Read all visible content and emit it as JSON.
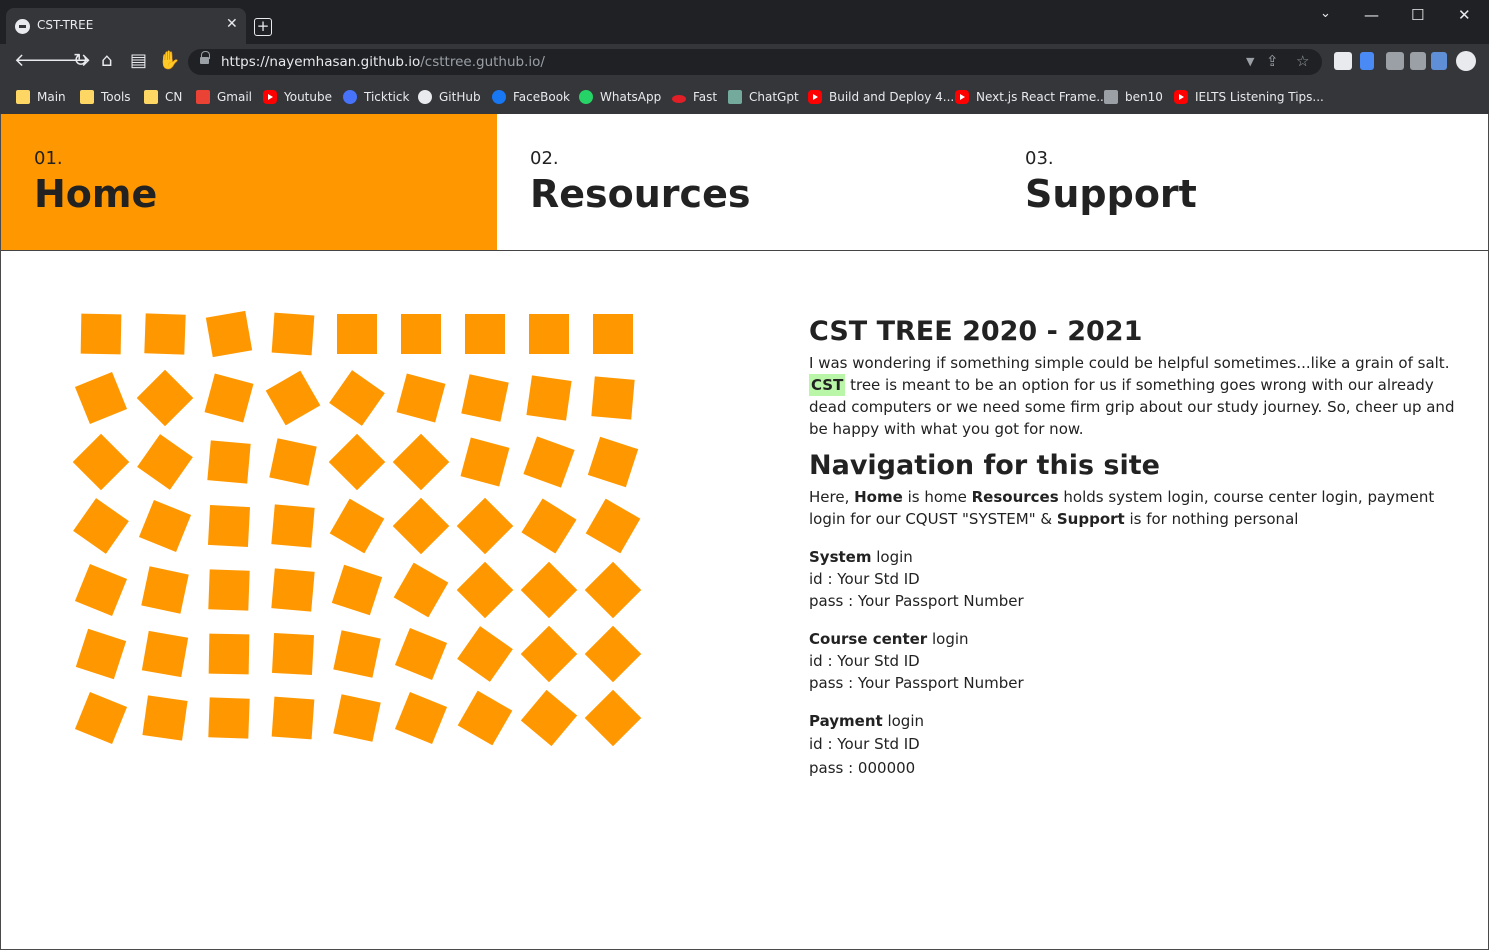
{
  "browser": {
    "tab_title": "CST-TREE",
    "tab_close": "✕",
    "new_tab": "+",
    "window_controls": [
      "⌄",
      "—",
      "☐",
      "✕"
    ],
    "url_host": "https://nayemhasan.github.io",
    "url_path": "/csttree.guthub.io/",
    "nav_icons": [
      "back-icon",
      "forward-icon",
      "reload-icon",
      "home-icon",
      "panel-icon",
      "hand-icon"
    ],
    "bookmarks": [
      {
        "label": "Main",
        "icon": "folder-icon"
      },
      {
        "label": "Tools",
        "icon": "folder-icon"
      },
      {
        "label": "CN",
        "icon": "folder-icon"
      },
      {
        "label": "Gmail",
        "icon": "gmail-icon"
      },
      {
        "label": "Youtube",
        "icon": "youtube-icon"
      },
      {
        "label": "Ticktick",
        "icon": "ticktick-icon"
      },
      {
        "label": "GitHub",
        "icon": "github-icon"
      },
      {
        "label": "FaceBook",
        "icon": "facebook-icon"
      },
      {
        "label": "WhatsApp",
        "icon": "whatsapp-icon"
      },
      {
        "label": "Fast",
        "icon": "fast-icon"
      },
      {
        "label": "ChatGpt",
        "icon": "chatgpt-icon"
      },
      {
        "label": "Build and Deploy 4...",
        "icon": "youtube-icon"
      },
      {
        "label": "Next.js React Frame...",
        "icon": "youtube-icon"
      },
      {
        "label": "ben10",
        "icon": "clapper-icon"
      },
      {
        "label": "IELTS Listening Tips...",
        "icon": "youtube-icon"
      }
    ]
  },
  "nav": [
    {
      "num": "01.",
      "label": "Home",
      "active": true
    },
    {
      "num": "02.",
      "label": "Resources",
      "active": false
    },
    {
      "num": "03.",
      "label": "Support",
      "active": false
    }
  ],
  "colors": {
    "accent": "#ff9800",
    "highlight": "#b9f6a8",
    "text": "#222222"
  },
  "intro": {
    "title": "CST TREE 2020 - 2021",
    "line1": "I was wondering if something simple could be helpful sometimes...like a grain of salt.",
    "cst": "CST",
    "line2": " tree is meant to be an option for us if something goes wrong with our already dead computers or we need some firm grip about our study journey. So, cheer up and be happy with what you got for now."
  },
  "navigation": {
    "title": "Navigation for this site",
    "t1": "Here, ",
    "home": "Home",
    "t2": " is home ",
    "resources": "Resources",
    "t3": " holds system login, course center login, payment login for our CQUST \"SYSTEM\" & ",
    "support": "Support",
    "t4": " is for nothing personal"
  },
  "logins": [
    {
      "name": "System",
      "suffix": " login",
      "id": "id : Your Std ID",
      "pass": "pass : Your Passport Number"
    },
    {
      "name": "Course center",
      "suffix": " login",
      "id": "id : Your Std ID",
      "pass": "pass : Your Passport Number"
    },
    {
      "name": "Payment",
      "suffix": " login",
      "id": "id : Your Std ID",
      "pass": "pass : 000000"
    }
  ]
}
